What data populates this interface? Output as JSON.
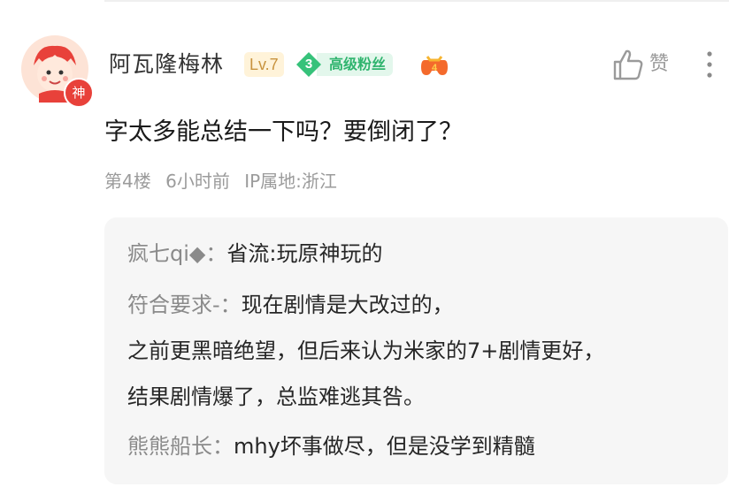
{
  "comment": {
    "username": "阿瓦隆梅林",
    "level": "Lv.7",
    "fan_level_num": "3",
    "fan_badge": "高级粉丝",
    "avatar_badge": "神",
    "text": "字太多能总结一下吗？要倒闭了？",
    "floor": "第4楼",
    "time": "6小时前",
    "ip": "IP属地:浙江",
    "like_label": "赞",
    "icons": {
      "avatar": "cartoon-avatar",
      "like": "thumb-up-icon",
      "more": "more-vertical-icon",
      "extra_badge": "game-controller-badge-icon"
    }
  },
  "replies": [
    {
      "author": "疯七qi◆",
      "sep": "：",
      "lines": [
        "省流:玩原神玩的"
      ]
    },
    {
      "author": "符合要求-",
      "sep": "：",
      "lines": [
        "现在剧情是大改过的，",
        "之前更黑暗绝望，但后来认为米家的7+剧情更好，",
        "结果剧情爆了，总监难逃其咎。"
      ]
    },
    {
      "author": "熊熊船长",
      "sep": "：",
      "lines": [
        "mhy坏事做尽，但是没学到精髓"
      ]
    }
  ],
  "colors": {
    "level_bg": "#fff3d9",
    "level_text": "#c8933e",
    "fan_green": "#2fb46e",
    "avatar_badge": "#e8413a",
    "reply_bg": "#f6f6f6"
  }
}
